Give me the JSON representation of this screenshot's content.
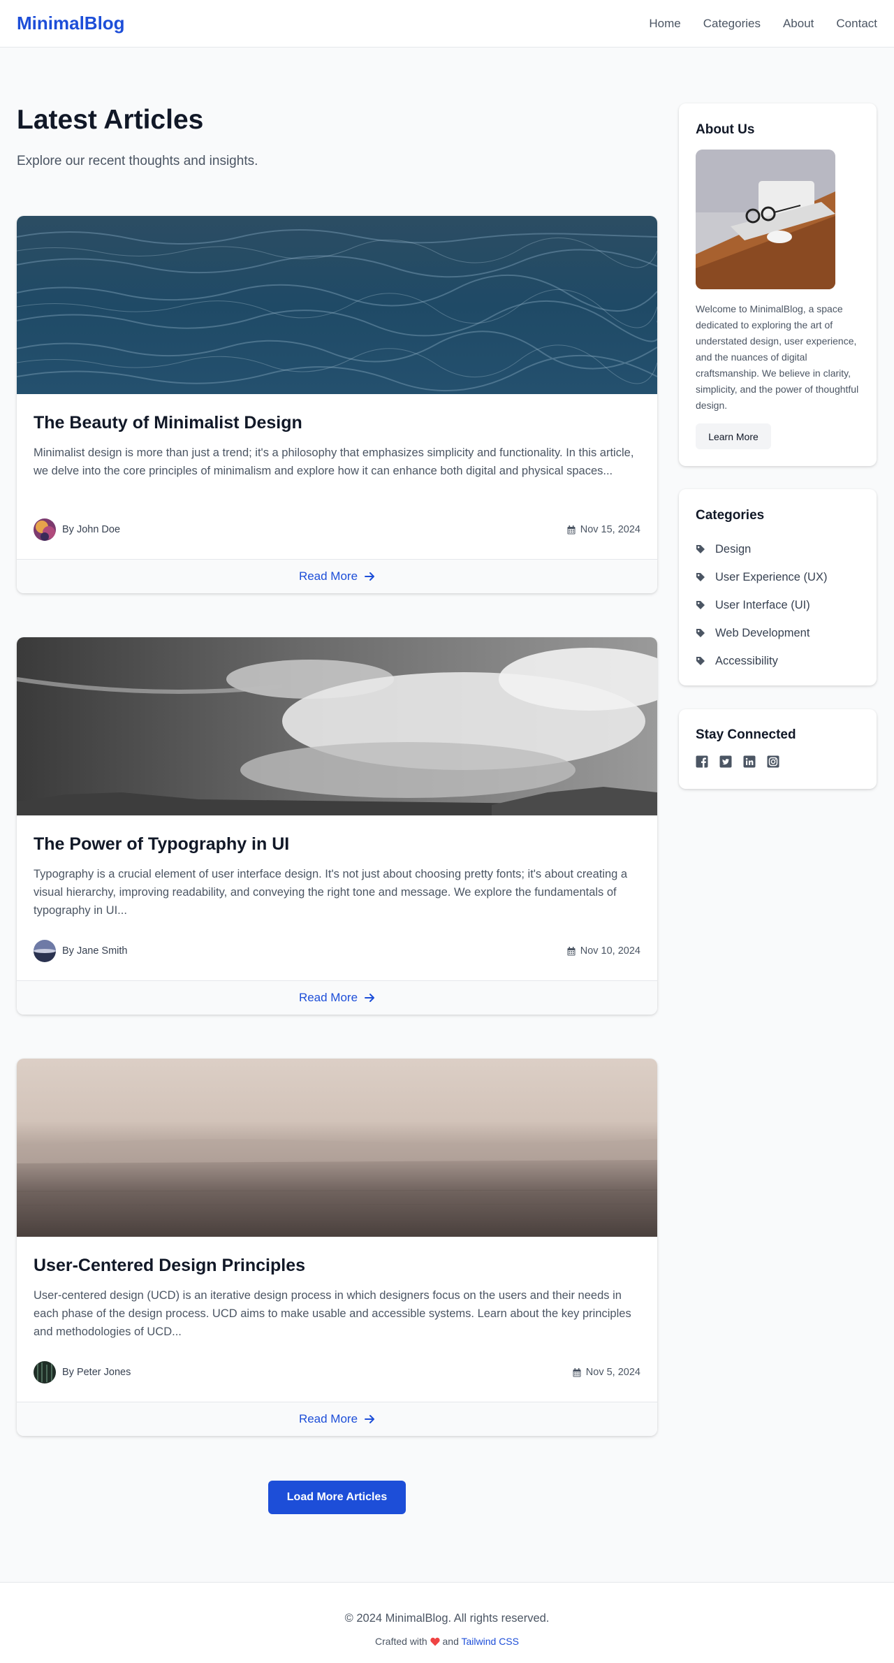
{
  "header": {
    "logo": "MinimalBlog",
    "nav": [
      "Home",
      "Categories",
      "About",
      "Contact"
    ]
  },
  "main": {
    "title": "Latest Articles",
    "subtitle": "Explore our recent thoughts and insights.",
    "articles": [
      {
        "title": "The Beauty of Minimalist Design",
        "excerpt": "Minimalist design is more than just a trend; it's a philosophy that emphasizes simplicity and functionality. In this article, we delve into the core principles of minimalism and explore how it can enhance both digital and physical spaces...",
        "author": "By John Doe",
        "date": "Nov 15, 2024",
        "read_more": "Read More"
      },
      {
        "title": "The Power of Typography in UI",
        "excerpt": "Typography is a crucial element of user interface design. It's not just about choosing pretty fonts; it's about creating a visual hierarchy, improving readability, and conveying the right tone and message. We explore the fundamentals of typography in UI...",
        "author": "By Jane Smith",
        "date": "Nov 10, 2024",
        "read_more": "Read More"
      },
      {
        "title": "User-Centered Design Principles",
        "excerpt": "User-centered design (UCD) is an iterative design process in which designers focus on the users and their needs in each phase of the design process. UCD aims to make usable and accessible systems. Learn about the key principles and methodologies of UCD...",
        "author": "By Peter Jones",
        "date": "Nov 5, 2024",
        "read_more": "Read More"
      }
    ],
    "load_more": "Load More Articles"
  },
  "sidebar": {
    "about": {
      "title": "About Us",
      "text": "Welcome to MinimalBlog, a space dedicated to exploring the art of understated design, user experience, and the nuances of digital craftsmanship. We believe in clarity, simplicity, and the power of thoughtful design.",
      "button": "Learn More"
    },
    "categories": {
      "title": "Categories",
      "items": [
        "Design",
        "User Experience (UX)",
        "User Interface (UI)",
        "Web Development",
        "Accessibility"
      ]
    },
    "social": {
      "title": "Stay Connected",
      "icons": [
        "facebook-icon",
        "twitter-icon",
        "linkedin-icon",
        "instagram-icon"
      ]
    }
  },
  "footer": {
    "copyright": "© 2024 MinimalBlog. All rights reserved.",
    "crafted_prefix": "Crafted with",
    "crafted_and": "and",
    "crafted_link": "Tailwind CSS"
  },
  "colors": {
    "accent": "#1d4ed8",
    "heart": "#ef4444"
  }
}
